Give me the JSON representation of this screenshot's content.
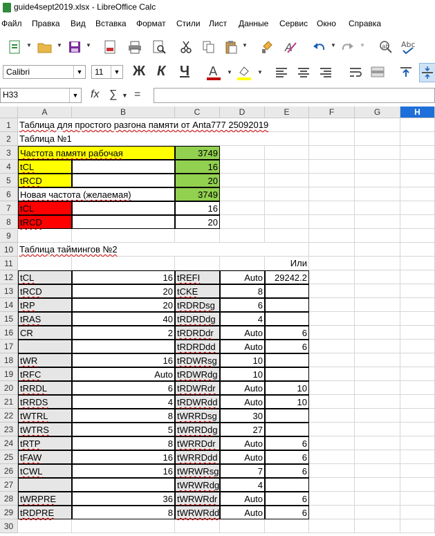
{
  "window": {
    "title": "guide4sept2019.xlsx - LibreOffice Calc"
  },
  "menu": [
    "Файл",
    "Правка",
    "Вид",
    "Вставка",
    "Формат",
    "Стили",
    "Лист",
    "Данные",
    "Сервис",
    "Окно",
    "Справка"
  ],
  "font": {
    "name": "Calibri",
    "size": "11"
  },
  "formula": {
    "cell_ref": "H33",
    "content": ""
  },
  "columns": [
    "A",
    "B",
    "C",
    "D",
    "E",
    "F",
    "G",
    "H"
  ],
  "rows": [
    "1",
    "2",
    "3",
    "4",
    "5",
    "6",
    "7",
    "8",
    "9",
    "10",
    "11",
    "12",
    "13",
    "14",
    "15",
    "16",
    "17",
    "18",
    "19",
    "20",
    "21",
    "22",
    "23",
    "24",
    "25",
    "26",
    "27",
    "28",
    "29",
    "30"
  ],
  "sheet": {
    "r1": "Таблица для простого разгона памяти от  Anta777 25092019",
    "r2": "Таблица №1",
    "r3a": "Частота памяти рабочая",
    "r3c": "3749",
    "r4a": "tCL",
    "r4c": "16",
    "r5a": "tRCD",
    "r5c": "20",
    "r6a": "Новая частота (желаемая)",
    "r6c": "3749",
    "r7a": "tCL",
    "r7c": "16",
    "r8a": "tRCD",
    "r8c": "20",
    "r10": "Таблица таймингов №2",
    "r11e": "Или",
    "t": [
      [
        "tCL",
        "16",
        "tREFI",
        "Auto",
        "29242.2"
      ],
      [
        "tRCD",
        "20",
        "tCKE",
        "8",
        ""
      ],
      [
        "tRP",
        "20",
        "tRDRDsg",
        "6",
        ""
      ],
      [
        "tRAS",
        "40",
        "tRDRDdg",
        "4",
        ""
      ],
      [
        "CR",
        "2",
        "tRDRDdr",
        "Auto",
        "6"
      ],
      [
        "",
        "",
        "tRDRDdd",
        "Auto",
        "6"
      ],
      [
        "tWR",
        "16",
        "tRDWRsg",
        "10",
        ""
      ],
      [
        "tRFC",
        "Auto",
        "tRDWRdg",
        "10",
        ""
      ],
      [
        "tRRDL",
        "6",
        "tRDWRdr",
        "Auto",
        "10"
      ],
      [
        "tRRDS",
        "4",
        "tRDWRdd",
        "Auto",
        "10"
      ],
      [
        "tWTRL",
        "8",
        "tWRRDsg",
        "30",
        ""
      ],
      [
        "tWTRS",
        "5",
        "tWRRDdg",
        "27",
        ""
      ],
      [
        "tRTP",
        "8",
        "tWRRDdr",
        "Auto",
        "6"
      ],
      [
        "tFAW",
        "16",
        "tWRRDdd",
        "Auto",
        "6"
      ],
      [
        "tCWL",
        "16",
        "tWRWRsg",
        "7",
        "6"
      ],
      [
        "",
        "",
        "tWRWRdg",
        "4",
        ""
      ],
      [
        "tWRPRE",
        "36",
        "tWRWRdr",
        "Auto",
        "6"
      ],
      [
        "tRDPRE",
        "8",
        "tWRWRdd",
        "Auto",
        "6"
      ]
    ]
  },
  "colors": {
    "yellow": "#ffff00",
    "green": "#92d050",
    "red": "#ff0000",
    "gray": "#e6e6e6",
    "selected_header": "#1e6fd9"
  }
}
